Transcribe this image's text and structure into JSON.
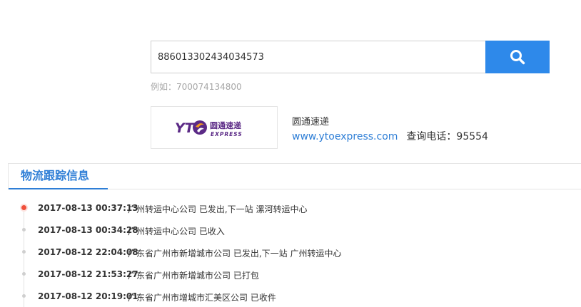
{
  "search": {
    "value": "886013302434034573",
    "example_hint": "例如：700074134800",
    "button_icon": "search-icon",
    "accent_color": "#2e89ea"
  },
  "carrier": {
    "logo_letters": "YT",
    "logo_cn": "圆通速递",
    "logo_en": "EXPRESS",
    "name": "圆通速递",
    "website": "www.ytoexpress.com",
    "phone_label": "查询电话：",
    "phone": "95554"
  },
  "tracking": {
    "tab_title": "物流跟踪信息",
    "events": [
      {
        "time": "2017-08-13 00:37:13",
        "description": "广州转运中心公司 已发出,下一站 漯河转运中心",
        "current": true
      },
      {
        "time": "2017-08-13 00:34:28",
        "description": "广州转运中心公司 已收入",
        "current": false
      },
      {
        "time": "2017-08-12 22:04:08",
        "description": "广东省广州市新增城市公司 已发出,下一站 广州转运中心",
        "current": false
      },
      {
        "time": "2017-08-12 21:53:27",
        "description": "广东省广州市新增城市公司 已打包",
        "current": false
      },
      {
        "time": "2017-08-12 20:19:01",
        "description": "广东省广州市增城市汇美区公司 已收件",
        "current": false
      }
    ]
  }
}
